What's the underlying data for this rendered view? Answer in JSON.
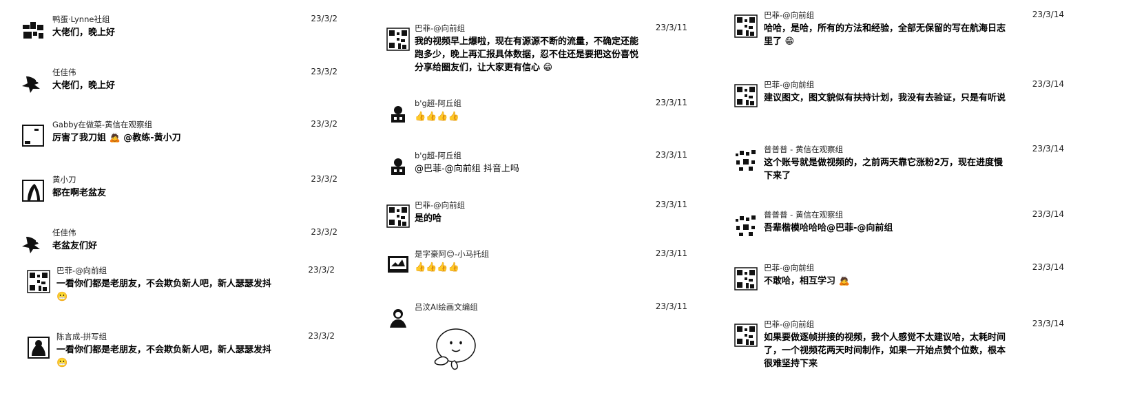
{
  "columns": [
    {
      "messages": [
        {
          "name": "鸭蛋·Lynne社组",
          "date": "23/3/2",
          "text": "大佬们，晚上好",
          "avatar": "bw-noise"
        },
        {
          "name": "任佳伟",
          "date": "23/3/2",
          "text": "大佬们，晚上好",
          "avatar": "bird"
        },
        {
          "name": "Gabby在做菜-黄信在观察组",
          "date": "23/3/2",
          "text": "厉害了我刀姐",
          "suffix_emoji": "🙇",
          "mention": "@教练-黄小刀",
          "avatar": "frame"
        },
        {
          "name": "黄小刀",
          "date": "23/3/2",
          "text": "都在啊老盆友",
          "avatar": "portrait"
        },
        {
          "name": "任佳伟",
          "date": "23/3/2",
          "text": "老盆友们好",
          "avatar": "bird"
        },
        {
          "name": "巴菲-@向前组",
          "date": "23/3/2",
          "text": "一看你们都是老朋友，不会欺负新人吧，新人瑟瑟发抖",
          "suffix_emoji": "😬",
          "avatar": "qr"
        },
        {
          "name": "陈言成-拼写组",
          "date": "23/3/2",
          "text": "一看你们都是老朋友，不会欺负新人吧，新人瑟瑟发抖",
          "suffix_emoji": "😬",
          "avatar": "frame-dark"
        }
      ]
    },
    {
      "messages": [
        {
          "name": "巴菲-@向前组",
          "date": "23/3/11",
          "text": "我的视频早上爆啦，现在有源源不断的流量，不确定还能跑多少，晚上再汇报具体数据，忍不住还是要把这份喜悦分享给圈友们，让大家更有信心",
          "suffix_emoji": "😁",
          "avatar": "qr"
        },
        {
          "name": "b'g超-阿丘组",
          "date": "23/3/11",
          "text": "👍👍👍👍",
          "avatar": "robot"
        },
        {
          "name": "b'g超-阿丘组",
          "date": "23/3/11",
          "text": "@巴菲-@向前组 抖音上吗",
          "avatar": "robot"
        },
        {
          "name": "巴菲-@向前组",
          "date": "23/3/11",
          "text": "是的哈",
          "avatar": "qr"
        },
        {
          "name": "是字豪阿😊-小马托组",
          "date": "23/3/11",
          "text": "👍👍👍👍",
          "avatar": "screen"
        },
        {
          "name": "吕汶AI绘画文编组",
          "date": "23/3/11",
          "text": "",
          "sticker": true,
          "avatar": "person"
        }
      ]
    },
    {
      "messages": [
        {
          "name": "巴菲-@向前组",
          "date": "23/3/14",
          "text": "哈哈，是哈，所有的方法和经验，全部无保留的写在航海日志里了",
          "suffix_emoji": "😁",
          "avatar": "qr"
        },
        {
          "name": "巴菲-@向前组",
          "date": "23/3/14",
          "text": "建议图文，图文貌似有扶持计划，我没有去验证，只是有听说",
          "avatar": "qr"
        },
        {
          "name": "普普普 - 黄信在观察组",
          "date": "23/3/14",
          "text": "这个账号就是做视频的，之前两天靠它涨粉2万，现在进度慢下来了",
          "avatar": "dots"
        },
        {
          "name": "普普普 - 黄信在观察组",
          "date": "23/3/14",
          "text": "吾辈楷模哈哈哈@巴菲-@向前组",
          "avatar": "dots"
        },
        {
          "name": "巴菲-@向前组",
          "date": "23/3/14",
          "text": "不敢哈，相互学习",
          "suffix_emoji": "🙇",
          "avatar": "qr"
        },
        {
          "name": "巴菲-@向前组",
          "date": "23/3/14",
          "text": "如果要做逐帧拼接的视频，我个人感觉不太建议哈，太耗时间了，一个视频花两天时间制作，如果一开始点赞个位数，根本很难坚持下来",
          "avatar": "qr"
        }
      ]
    }
  ]
}
